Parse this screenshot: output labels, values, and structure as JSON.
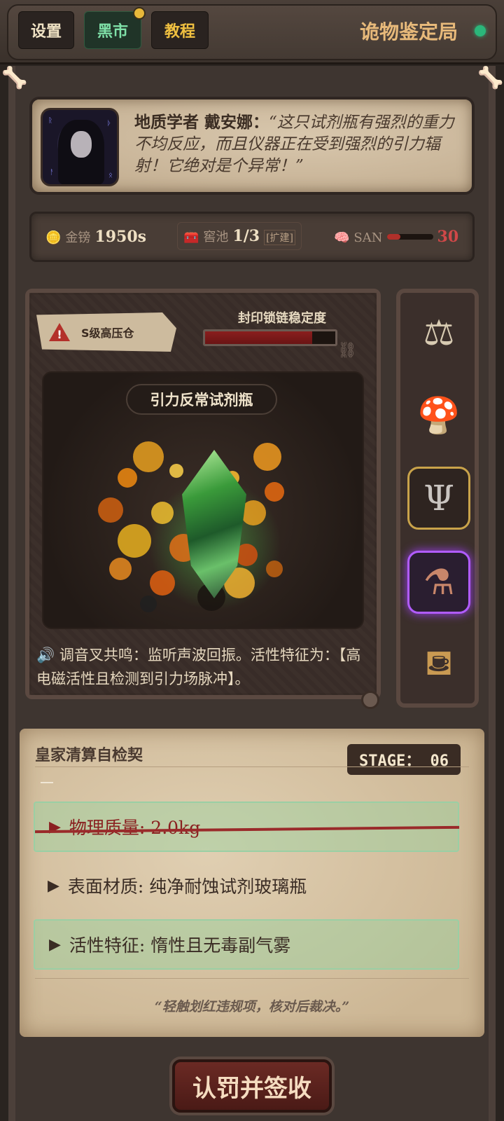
{
  "topbar": {
    "settings_label": "设置",
    "market_label": "黑市",
    "tutorial_label": "教程",
    "app_title": "诡物鉴定局",
    "market_has_notification": true,
    "status_color": "#2bb67a"
  },
  "dialogue": {
    "speaker": "地质学者 戴安娜：",
    "quote": "“这只试剂瓶有强烈的重力不均反应，而且仪器正在受到强烈的引力辐射！它绝对是个异常！”"
  },
  "resources": {
    "gold_label": "金镑",
    "gold_value": "1950s",
    "vault_label": "窖池",
    "vault_value": "1/3",
    "vault_expand": "[扩建]",
    "san_label": "SAN",
    "san_value": "30",
    "san_level": 0.3
  },
  "chamber": {
    "warning_label": "S级高压仓",
    "chain_label": "封印锁链稳定度",
    "chain_stability": 0.82,
    "artifact_name": "引力反常试剂瓶",
    "description": "调音叉共鸣：监听声波回振。活性特征为：【高电磁活性且检测到引力场脉冲】。"
  },
  "tools": [
    {
      "name": "scale-skull-icon",
      "glyph": "⚖",
      "state": "normal"
    },
    {
      "name": "mushroom-lantern-icon",
      "glyph": "🍄",
      "state": "normal"
    },
    {
      "name": "tuning-fork-icon",
      "glyph": "Ψ",
      "state": "selected"
    },
    {
      "name": "potion-bottles-icon",
      "glyph": "⚗",
      "state": "highlighted"
    },
    {
      "name": "brass-kettle-icon",
      "glyph": "⛾",
      "state": "normal"
    }
  ],
  "contract": {
    "title": "皇家清算自检契",
    "stage": "STAGE： 06",
    "clauses": [
      {
        "arrow": "▶",
        "text": "物理质量: 2.0kg",
        "state": "struck"
      },
      {
        "arrow": "▶",
        "text": "表面材质: 纯净耐蚀试剂玻璃瓶",
        "state": "plain"
      },
      {
        "arrow": "▶",
        "text": "活性特征: 惰性且无毒副气雾",
        "state": "verified"
      }
    ],
    "hint": "“轻触划红违规项，核对后裁决。”"
  },
  "sign_button_label": "认罚并签收"
}
